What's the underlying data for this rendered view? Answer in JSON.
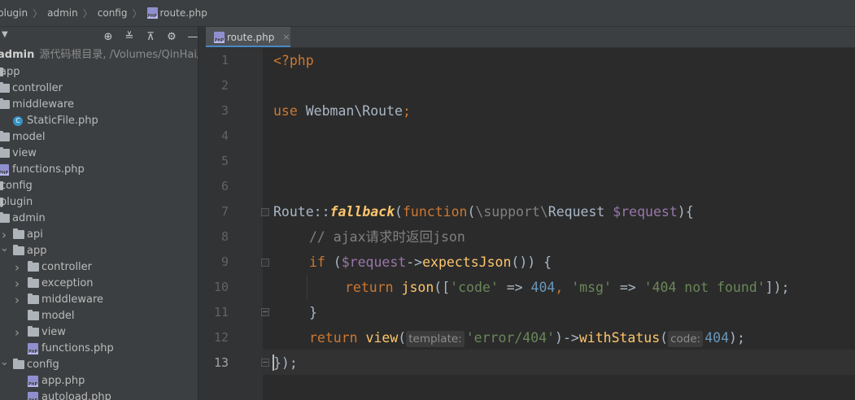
{
  "breadcrumb": {
    "items": [
      "plugin",
      "admin",
      "config"
    ],
    "file": "route.php"
  },
  "project_panel": {
    "dropdown_icon": "chevron-down-icon",
    "tools": [
      "locate-icon",
      "expand-all-icon",
      "collapse-all-icon",
      "gear-icon",
      "minimize-icon"
    ],
    "root": {
      "name": "admin",
      "hint": "源代码根目录, /Volumes/QinHai/ad"
    },
    "tree": [
      {
        "label": "app",
        "type": "folder",
        "depth": 0,
        "arrow": ""
      },
      {
        "label": "controller",
        "type": "folder",
        "depth": 1,
        "arrow": ""
      },
      {
        "label": "middleware",
        "type": "folder",
        "depth": 1,
        "arrow": ""
      },
      {
        "label": "StaticFile.php",
        "type": "class",
        "depth": 2,
        "arrow": ""
      },
      {
        "label": "model",
        "type": "folder",
        "depth": 1,
        "arrow": ""
      },
      {
        "label": "view",
        "type": "folder",
        "depth": 1,
        "arrow": ""
      },
      {
        "label": "functions.php",
        "type": "php",
        "depth": 1,
        "arrow": ""
      },
      {
        "label": "config",
        "type": "folder",
        "depth": 0,
        "arrow": ""
      },
      {
        "label": "plugin",
        "type": "folder",
        "depth": 0,
        "arrow": ""
      },
      {
        "label": "admin",
        "type": "folder",
        "depth": 1,
        "arrow": ""
      },
      {
        "label": "api",
        "type": "folder",
        "depth": 2,
        "arrow": "right"
      },
      {
        "label": "app",
        "type": "folder",
        "depth": 2,
        "arrow": "down"
      },
      {
        "label": "controller",
        "type": "folder",
        "depth": 3,
        "arrow": "right"
      },
      {
        "label": "exception",
        "type": "folder",
        "depth": 3,
        "arrow": "right"
      },
      {
        "label": "middleware",
        "type": "folder",
        "depth": 3,
        "arrow": "right"
      },
      {
        "label": "model",
        "type": "folder",
        "depth": 3,
        "arrow": ""
      },
      {
        "label": "view",
        "type": "folder",
        "depth": 3,
        "arrow": "right"
      },
      {
        "label": "functions.php",
        "type": "php",
        "depth": 3,
        "arrow": ""
      },
      {
        "label": "config",
        "type": "folder",
        "depth": 2,
        "arrow": "down"
      },
      {
        "label": "app.php",
        "type": "php",
        "depth": 3,
        "arrow": ""
      },
      {
        "label": "autoload.php",
        "type": "php",
        "depth": 3,
        "arrow": ""
      }
    ]
  },
  "editor": {
    "tab": {
      "label": "route.php",
      "close": "×"
    },
    "current_line": 13,
    "line_numbers": [
      "1",
      "2",
      "3",
      "4",
      "5",
      "6",
      "7",
      "8",
      "9",
      "10",
      "11",
      "12",
      "13"
    ],
    "code": {
      "l1_open": "<?php",
      "l3_use": "use",
      "l3_ns": "Webman\\Route",
      "l3_semi": ";",
      "l7_class": "Route::",
      "l7_method": "fallback",
      "l7_paren": "(",
      "l7_function": "function",
      "l7_paren2": "(",
      "l7_ns": "\\support\\",
      "l7_type": "Request ",
      "l7_var": "$request",
      "l7_end": "){",
      "l8_comment": "// ajax请求时返回json",
      "l9_if": "if",
      "l9_open": " (",
      "l9_var": "$request",
      "l9_arrow": "->",
      "l9_call": "expectsJson",
      "l9_end": "()) {",
      "l10_return": "return",
      "l10_json": "json",
      "l10_open": "([",
      "l10_k1": "'code'",
      "l10_op1": " => ",
      "l10_v1": "404",
      "l10_comma": ", ",
      "l10_k2": "'msg'",
      "l10_op2": " => ",
      "l10_v2": "'404 not found'",
      "l10_end": "]);",
      "l11_close": "}",
      "l12_return": "return",
      "l12_view": "view",
      "l12_open": "(",
      "l12_hint1": "template:",
      "l12_arg1": "'error/404'",
      "l12_mid": ")->",
      "l12_with": "withStatus",
      "l12_open2": "(",
      "l12_hint2": "code:",
      "l12_arg2": "404",
      "l12_end": ");",
      "l13_close": "});"
    }
  },
  "colors": {
    "keyword": "#cc7832",
    "function": "#ffc66d",
    "variable": "#9876aa",
    "string": "#6a8759",
    "number": "#6897bb",
    "comment": "#808080",
    "tab_underline": "#4a88c7"
  }
}
